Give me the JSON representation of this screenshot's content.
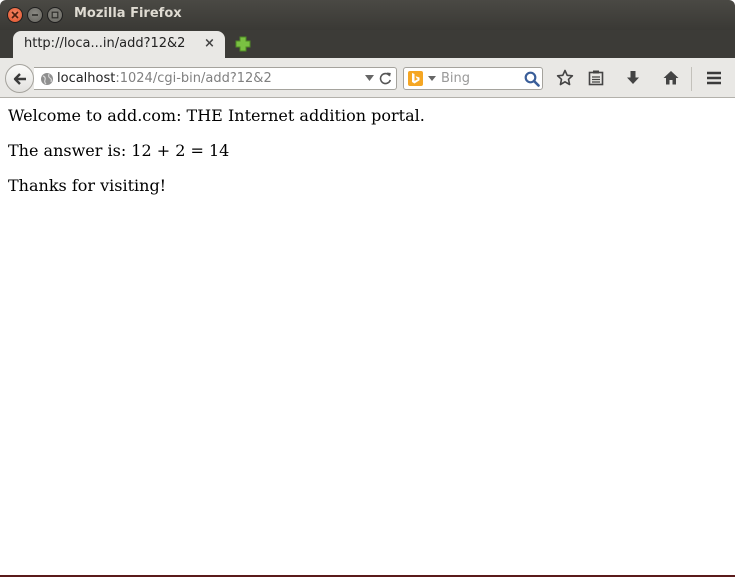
{
  "window": {
    "title": "Mozilla Firefox"
  },
  "tab": {
    "title": "http://loca...in/add?12&2",
    "close_glyph": "×"
  },
  "navbar": {
    "url_host": "localhost",
    "url_rest": ":1024/cgi-bin/add?12&2",
    "search_placeholder": "Bing"
  },
  "page": {
    "lines": [
      "Welcome to add.com: THE Internet addition portal.",
      "The answer is: 12 + 2 = 14",
      "Thanks for visiting!"
    ]
  },
  "colors": {
    "titlebar": "#3c3b37",
    "close_button": "#e0522b",
    "toolbar": "#e9e8e5",
    "newtab_plus": "#7ac142",
    "bing": "#f5a623"
  },
  "icons": {
    "window_close": "close-icon",
    "window_minimize": "minimize-icon",
    "window_maximize": "maximize-icon",
    "new_tab": "plus-icon",
    "back": "back-arrow-icon",
    "site": "globe-icon",
    "url_history": "chevron-down-icon",
    "reload": "reload-icon",
    "search_engine": "bing-icon",
    "search": "magnifier-icon",
    "bookmark": "star-icon",
    "reading_list": "clipboard-icon",
    "downloads": "download-arrow-icon",
    "home": "home-icon",
    "menu": "hamburger-menu-icon"
  }
}
